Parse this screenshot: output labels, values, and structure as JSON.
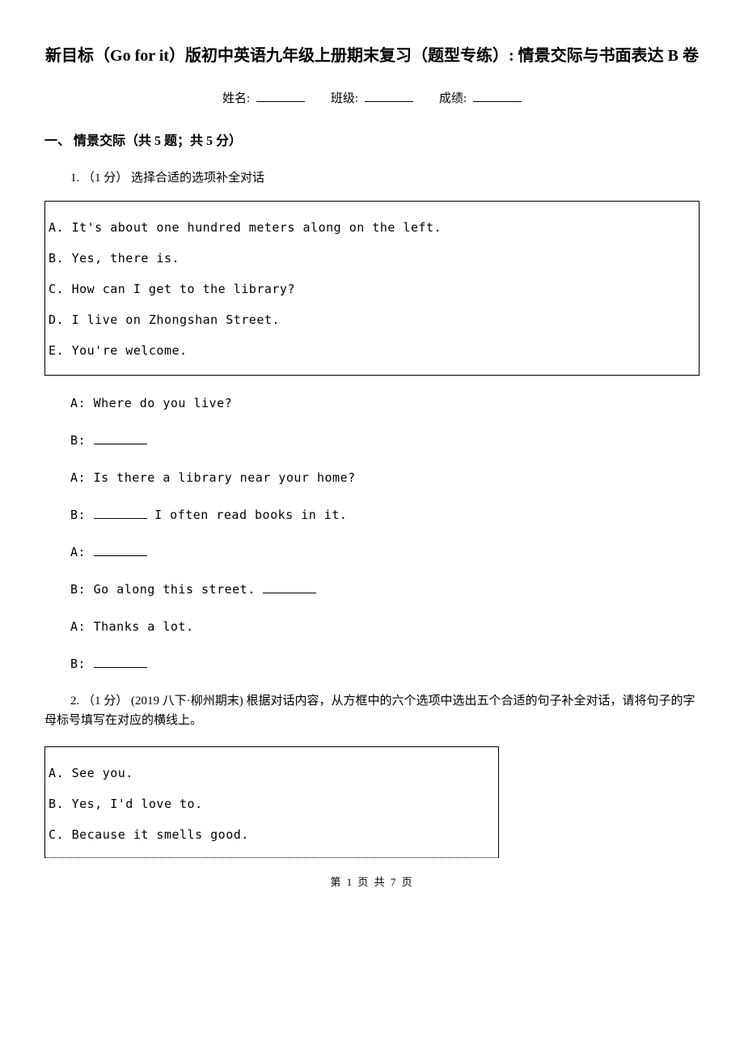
{
  "title": "新目标（Go for it）版初中英语九年级上册期末复习（题型专练）: 情景交际与书面表达 B 卷",
  "info": {
    "name_label": "姓名:",
    "class_label": "班级:",
    "score_label": "成绩:"
  },
  "section1": {
    "heading": "一、 情景交际（共 5 题；共 5 分）",
    "q1": {
      "intro": "1. （1 分） 选择合适的选项补全对话",
      "options": {
        "a": "A. It's about one hundred meters along on the left.",
        "b": "B. Yes, there is.",
        "c": "C. How can I get to the library?",
        "d": "D. I live on Zhongshan Street.",
        "e": "E. You're welcome."
      },
      "dialog": {
        "l1": "A: Where do you live?",
        "l2": "B: ",
        "l3": "A: Is there a library near your home?",
        "l4a": "B: ",
        "l4b": "  I often read books in it.",
        "l5": "A: ",
        "l6a": "B: Go along this street. ",
        "l7": "A: Thanks a lot.",
        "l8": "B: "
      }
    },
    "q2": {
      "intro": "2. （1 分） (2019 八下·柳州期末) 根据对话内容，从方框中的六个选项中选出五个合适的句子补全对话，请将句子的字母标号填写在对应的横线上。",
      "options": {
        "a": "A. See you.",
        "b": "B. Yes, I'd love to.",
        "c": "C. Because it smells good."
      }
    }
  },
  "footer": "第 1 页 共 7 页"
}
